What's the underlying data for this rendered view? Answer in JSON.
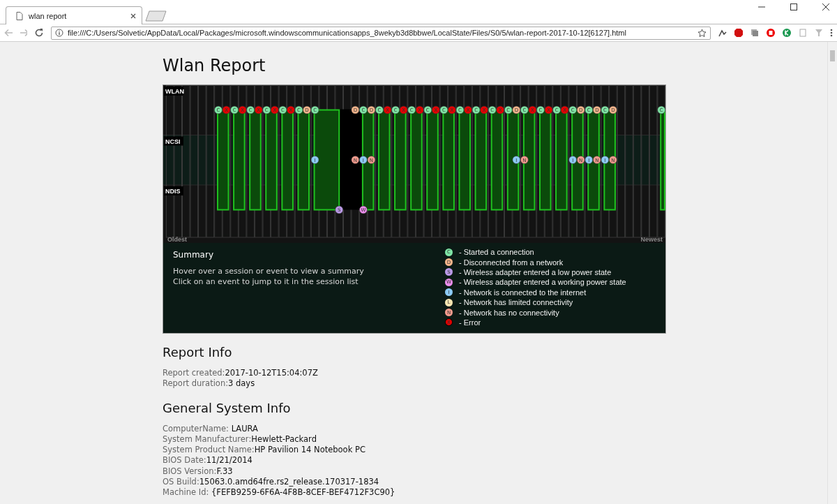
{
  "browser": {
    "tab_title": "wlan report",
    "url": "file:///C:/Users/Solvetic/AppData/Local/Packages/microsoft.windowscommunicationsapps_8wekyb3d8bbwe/LocalState/Files/S0/5/wlan-report-2017-10-12[6127].html"
  },
  "page": {
    "title": "Wlan Report"
  },
  "timeline": {
    "rows": [
      {
        "label": "WLAN"
      },
      {
        "label": "NCSI"
      },
      {
        "label": "NDIS"
      }
    ],
    "oldest_label": "Oldest",
    "newest_label": "Newest",
    "slots": [
      {
        "kind": "empty"
      },
      {
        "kind": "empty"
      },
      {
        "kind": "empty"
      },
      {
        "kind": "empty"
      },
      {
        "kind": "empty"
      },
      {
        "kind": "empty"
      },
      {
        "kind": "event",
        "wlan": {
          "letter": "C",
          "kind": "connect"
        }
      },
      {
        "kind": "event",
        "wlan": {
          "letter": "X",
          "kind": "error"
        }
      },
      {
        "kind": "event",
        "wlan": {
          "letter": "C",
          "kind": "connect"
        }
      },
      {
        "kind": "event",
        "wlan": {
          "letter": "X",
          "kind": "error"
        }
      },
      {
        "kind": "event",
        "wlan": {
          "letter": "C",
          "kind": "connect"
        }
      },
      {
        "kind": "event",
        "wlan": {
          "letter": "X",
          "kind": "error"
        }
      },
      {
        "kind": "event",
        "wlan": {
          "letter": "C",
          "kind": "connect"
        }
      },
      {
        "kind": "event",
        "wlan": {
          "letter": "X",
          "kind": "error"
        }
      },
      {
        "kind": "event",
        "wlan": {
          "letter": "C",
          "kind": "connect"
        }
      },
      {
        "kind": "event",
        "wlan": {
          "letter": "X",
          "kind": "error"
        }
      },
      {
        "kind": "event",
        "wlan": {
          "letter": "C",
          "kind": "connect"
        }
      },
      {
        "kind": "event",
        "wlan": {
          "letter": "D",
          "kind": "disconnect"
        }
      },
      {
        "kind": "event",
        "wlan": {
          "letter": "C",
          "kind": "connect"
        },
        "ncsi": {
          "letter": "I",
          "kind": "internet"
        }
      },
      {
        "kind": "empty"
      },
      {
        "kind": "empty"
      },
      {
        "kind": "event",
        "ndis": {
          "letter": "S",
          "kind": "low_power"
        }
      },
      {
        "kind": "empty"
      },
      {
        "kind": "event",
        "wlan": {
          "letter": "D",
          "kind": "disconnect"
        },
        "ncsi": {
          "letter": "N",
          "kind": "no_connectivity"
        }
      },
      {
        "kind": "event",
        "wlan": {
          "letter": "C",
          "kind": "connect"
        },
        "ncsi": {
          "letter": "I",
          "kind": "internet"
        },
        "ndis": {
          "letter": "W",
          "kind": "working_power"
        }
      },
      {
        "kind": "event",
        "wlan": {
          "letter": "D",
          "kind": "disconnect"
        },
        "ncsi": {
          "letter": "N",
          "kind": "no_connectivity"
        }
      },
      {
        "kind": "event",
        "wlan": {
          "letter": "C",
          "kind": "connect"
        }
      },
      {
        "kind": "event",
        "wlan": {
          "letter": "X",
          "kind": "error"
        }
      },
      {
        "kind": "event",
        "wlan": {
          "letter": "C",
          "kind": "connect"
        }
      },
      {
        "kind": "event",
        "wlan": {
          "letter": "X",
          "kind": "error"
        }
      },
      {
        "kind": "event",
        "wlan": {
          "letter": "C",
          "kind": "connect"
        }
      },
      {
        "kind": "event",
        "wlan": {
          "letter": "X",
          "kind": "error"
        }
      },
      {
        "kind": "event",
        "wlan": {
          "letter": "C",
          "kind": "connect"
        }
      },
      {
        "kind": "event",
        "wlan": {
          "letter": "X",
          "kind": "error"
        }
      },
      {
        "kind": "event",
        "wlan": {
          "letter": "C",
          "kind": "connect"
        }
      },
      {
        "kind": "event",
        "wlan": {
          "letter": "X",
          "kind": "error"
        }
      },
      {
        "kind": "event",
        "wlan": {
          "letter": "C",
          "kind": "connect"
        }
      },
      {
        "kind": "event",
        "wlan": {
          "letter": "X",
          "kind": "error"
        }
      },
      {
        "kind": "event",
        "wlan": {
          "letter": "C",
          "kind": "connect"
        }
      },
      {
        "kind": "event",
        "wlan": {
          "letter": "X",
          "kind": "error"
        }
      },
      {
        "kind": "event",
        "wlan": {
          "letter": "C",
          "kind": "connect"
        }
      },
      {
        "kind": "event",
        "wlan": {
          "letter": "X",
          "kind": "error"
        }
      },
      {
        "kind": "event",
        "wlan": {
          "letter": "C",
          "kind": "connect"
        }
      },
      {
        "kind": "event",
        "wlan": {
          "letter": "D",
          "kind": "disconnect"
        },
        "ncsi": {
          "letter": "I",
          "kind": "internet"
        }
      },
      {
        "kind": "event",
        "wlan": {
          "letter": "C",
          "kind": "connect"
        },
        "ncsi": {
          "letter": "N",
          "kind": "no_connectivity"
        }
      },
      {
        "kind": "event",
        "wlan": {
          "letter": "X",
          "kind": "error"
        }
      },
      {
        "kind": "event",
        "wlan": {
          "letter": "C",
          "kind": "connect"
        }
      },
      {
        "kind": "event",
        "wlan": {
          "letter": "X",
          "kind": "error"
        }
      },
      {
        "kind": "event",
        "wlan": {
          "letter": "C",
          "kind": "connect"
        }
      },
      {
        "kind": "event",
        "wlan": {
          "letter": "X",
          "kind": "error"
        }
      },
      {
        "kind": "event",
        "wlan": {
          "letter": "C",
          "kind": "connect"
        },
        "ncsi": {
          "letter": "I",
          "kind": "internet"
        }
      },
      {
        "kind": "event",
        "wlan": {
          "letter": "D",
          "kind": "disconnect"
        },
        "ncsi": {
          "letter": "N",
          "kind": "no_connectivity"
        }
      },
      {
        "kind": "event",
        "wlan": {
          "letter": "C",
          "kind": "connect"
        },
        "ncsi": {
          "letter": "I",
          "kind": "internet"
        }
      },
      {
        "kind": "event",
        "wlan": {
          "letter": "D",
          "kind": "disconnect"
        },
        "ncsi": {
          "letter": "N",
          "kind": "no_connectivity"
        }
      },
      {
        "kind": "event",
        "wlan": {
          "letter": "C",
          "kind": "connect"
        },
        "ncsi": {
          "letter": "I",
          "kind": "internet"
        }
      },
      {
        "kind": "event",
        "wlan": {
          "letter": "D",
          "kind": "disconnect"
        },
        "ncsi": {
          "letter": "N",
          "kind": "no_connectivity"
        }
      },
      {
        "kind": "empty"
      },
      {
        "kind": "empty"
      },
      {
        "kind": "empty"
      },
      {
        "kind": "empty"
      },
      {
        "kind": "empty"
      },
      {
        "kind": "event",
        "wlan": {
          "letter": "C",
          "kind": "connect"
        }
      }
    ]
  },
  "summary": {
    "title": "Summary",
    "lines": [
      "Hover over a session or event to view a summary",
      "Click on an event to jump to it in the session list"
    ]
  },
  "legend": [
    {
      "letter": "C",
      "kind": "connect",
      "text": "- Started a connection"
    },
    {
      "letter": "D",
      "kind": "disconnect",
      "text": "- Disconnected from a network"
    },
    {
      "letter": "S",
      "kind": "low_power",
      "text": "- Wireless adapter entered a low power state"
    },
    {
      "letter": "W",
      "kind": "working_power",
      "text": "- Wireless adapter entered a working power state"
    },
    {
      "letter": "I",
      "kind": "internet",
      "text": "- Network is connected to the internet"
    },
    {
      "letter": "L",
      "kind": "limited",
      "text": "- Network has limited connectivity"
    },
    {
      "letter": "N",
      "kind": "no_connectivity",
      "text": "- Network has no connectivity"
    },
    {
      "letter": "X",
      "kind": "error",
      "text": "- Error"
    }
  ],
  "sections": [
    {
      "heading": "Report Info",
      "fields": [
        {
          "label": "Report created:",
          "value": "2017-10-12T15:04:07Z"
        },
        {
          "label": "Report duration:",
          "value": "3 days"
        }
      ]
    },
    {
      "heading": "General System Info",
      "fields": [
        {
          "label": "ComputerName: ",
          "value": "LAURA"
        },
        {
          "label": "System Manufacturer:",
          "value": "Hewlett-Packard"
        },
        {
          "label": "System Product Name:",
          "value": "HP Pavilion 14 Notebook PC"
        },
        {
          "label": "BIOS Date:",
          "value": "11/21/2014"
        },
        {
          "label": "BIOS Version:",
          "value": "F.33"
        },
        {
          "label": "OS Build:",
          "value": "15063.0.amd64fre.rs2_release.170317-1834"
        },
        {
          "label": "Machine Id: ",
          "value": "{FEFB9259-6F6A-4F8B-8CEF-BEF4712F3C90}"
        }
      ]
    }
  ]
}
